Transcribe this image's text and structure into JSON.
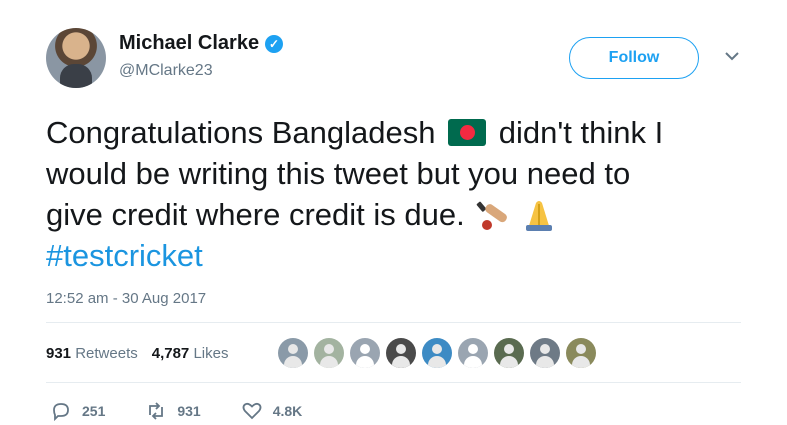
{
  "author": {
    "name": "Michael Clarke",
    "handle": "@MClarke23",
    "verified_icon": "verified-badge-icon"
  },
  "follow_button": {
    "label": "Follow"
  },
  "tweet": {
    "line1_part1": "Congratulations Bangladesh",
    "flag_emoji": "bangladesh-flag-emoji",
    "line1_part2": "didn't think I",
    "line2": "would be writing this tweet but you need to",
    "line3": "give credit where credit is due.",
    "trailing_emojis": [
      "cricket-bat-emoji",
      "folded-hands-emoji"
    ],
    "hashtag": "#testcricket"
  },
  "timestamp": "12:52 am - 30 Aug 2017",
  "stats": {
    "retweets_count": "931",
    "retweets_label": "Retweets",
    "likes_count": "4,787",
    "likes_label": "Likes"
  },
  "liker_avatars_count": 9,
  "actions": {
    "reply_count": "251",
    "retweet_count": "931",
    "like_count": "4.8K"
  },
  "colors": {
    "accent": "#1da1f2",
    "hashtag": "#1b95e0",
    "muted": "#657786",
    "text": "#14171a"
  }
}
